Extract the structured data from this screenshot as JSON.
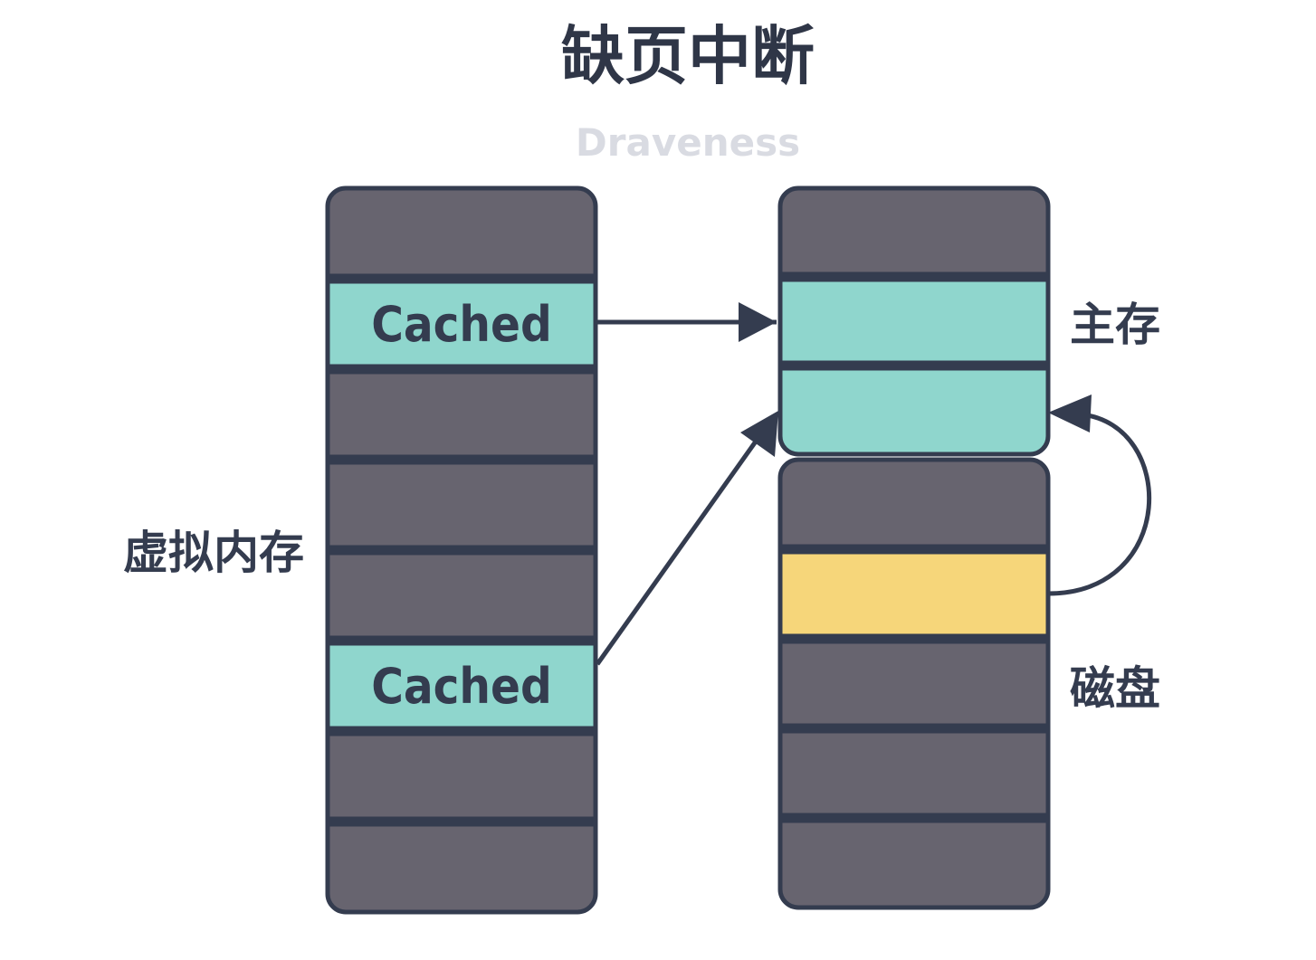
{
  "title": "缺页中断",
  "watermark": "Draveness",
  "labels": {
    "virtual_memory": "虚拟内存",
    "main_memory": "主存",
    "disk": "磁盘"
  },
  "virtual_memory_rows": [
    {
      "state": "empty",
      "text": ""
    },
    {
      "state": "cached",
      "text": "Cached"
    },
    {
      "state": "empty",
      "text": ""
    },
    {
      "state": "empty",
      "text": ""
    },
    {
      "state": "empty",
      "text": ""
    },
    {
      "state": "cached",
      "text": "Cached"
    },
    {
      "state": "empty",
      "text": ""
    },
    {
      "state": "empty",
      "text": ""
    }
  ],
  "main_memory_rows": [
    {
      "state": "empty"
    },
    {
      "state": "cached"
    },
    {
      "state": "cached"
    }
  ],
  "disk_rows": [
    {
      "state": "empty"
    },
    {
      "state": "loading"
    },
    {
      "state": "empty"
    },
    {
      "state": "empty"
    },
    {
      "state": "empty"
    }
  ],
  "colors": {
    "outline": "#343c4f",
    "empty": "#67646f",
    "cached": "#8fd6cd",
    "loading": "#f6d67a",
    "title": "#2f3647",
    "watermark": "#d9dbe2",
    "label": "#343c4f"
  }
}
